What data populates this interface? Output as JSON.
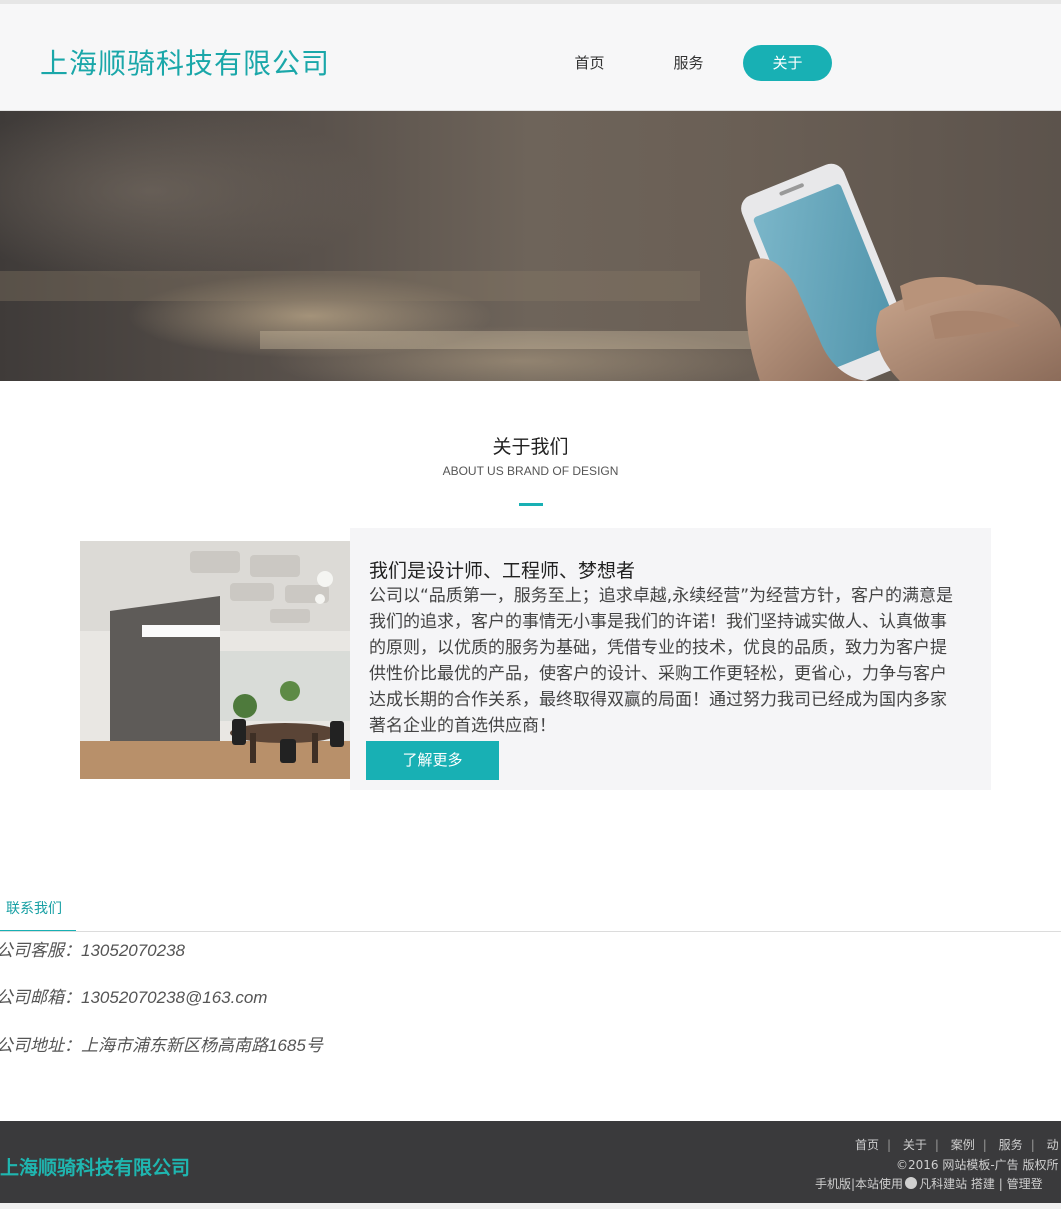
{
  "header": {
    "brand": "上海顺骑科技有限公司",
    "nav": [
      {
        "label": "首页",
        "active": false
      },
      {
        "label": "服务",
        "active": false
      },
      {
        "label": "关于",
        "active": true
      }
    ]
  },
  "about": {
    "title": "关于我们",
    "subtitle": "ABOUT US BRAND OF DESIGN",
    "card_heading": "我们是设计师、工程师、梦想者",
    "card_body": "公司以“品质第一，服务至上；追求卓越,永续经营”为经营方针，客户的满意是我们的追求，客户的事情无小事是我们的许诺！我们坚持诚实做人、认真做事的原则，以优质的服务为基础，凭借专业的技术，优良的品质，致力为客户提供性价比最优的产品，使客户的设计、采购工作更轻松，更省心，力争与客户达成长期的合作关系，最终取得双赢的局面！通过努力我司已经成为国内多家著名企业的首选供应商！",
    "more_button": "了解更多"
  },
  "contact": {
    "tab": "联系我们",
    "phone": "公司客服：13052070238",
    "email": "公司邮箱：13052070238@163.com",
    "address": "公司地址：上海市浦东新区杨高南路1685号"
  },
  "footer": {
    "brand": "上海顺骑科技有限公司",
    "links": [
      "首页",
      "关于",
      "案例",
      "服务",
      "动"
    ],
    "copyright": "©2016 网站模板-广告 版权所",
    "mobile": "手机版",
    "built_prefix": "|本站使用",
    "builder": "凡科建站",
    "built_suffix": "搭建",
    "admin": "| 管理登"
  },
  "colors": {
    "accent": "#18b0b4",
    "footer_bg": "#3a3a3c"
  }
}
